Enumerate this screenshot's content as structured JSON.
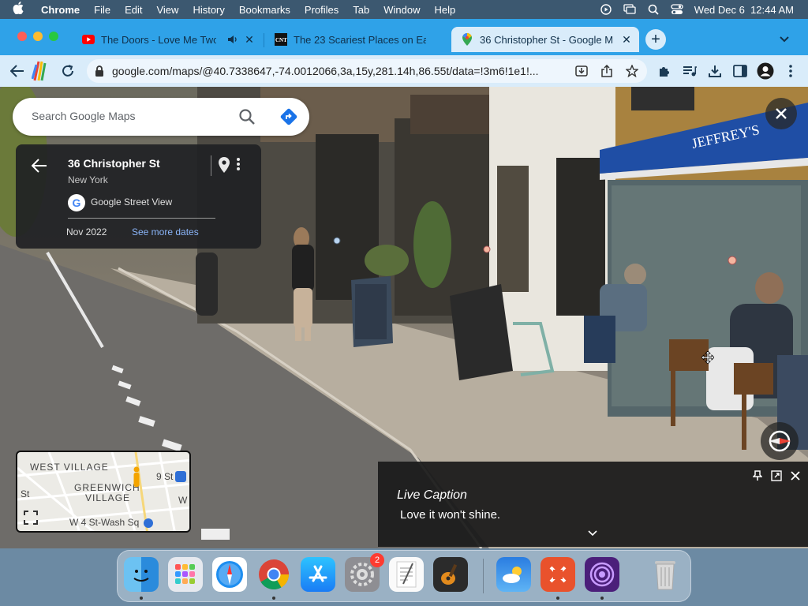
{
  "menubar": {
    "app_name": "Chrome",
    "items": [
      "File",
      "Edit",
      "View",
      "History",
      "Bookmarks",
      "Profiles",
      "Tab",
      "Window",
      "Help"
    ],
    "clock": "Wed Dec 6  12:44 AM",
    "status_icons": [
      "play-circle-icon",
      "screen-mirror-icon",
      "search-icon",
      "control-center-icon"
    ]
  },
  "tabs": [
    {
      "title": "The Doors - Love Me Two",
      "favicon": "youtube-icon",
      "audio": true,
      "active": false
    },
    {
      "title": "The 23 Scariest Places on Ea",
      "favicon": "cnt-icon",
      "audio": false,
      "active": false
    },
    {
      "title": "36 Christopher St - Google M",
      "favicon": "google-maps-icon",
      "audio": false,
      "active": true
    }
  ],
  "toolbar": {
    "url": "google.com/maps/@40.7338647,-74.0012066,3a,15y,281.14h,86.55t/data=!3m6!1e1!..."
  },
  "maps": {
    "search_placeholder": "Search Google Maps",
    "place_name": "36 Christopher St",
    "city": "New York",
    "provider": "Google Street View",
    "capture_date": "Nov 2022",
    "see_more": "See more dates",
    "minimap": {
      "labels": [
        "WEST VILLAGE",
        "GREENWICH",
        "VILLAGE",
        "9 St",
        "W 4 St-Wash Sq",
        "St",
        "W"
      ]
    }
  },
  "caption": {
    "title": "Live Caption",
    "text": "Love it won't shine."
  },
  "dock": {
    "apps": [
      {
        "name": "Finder",
        "icon": "finder-icon",
        "running": true
      },
      {
        "name": "Launchpad",
        "icon": "launchpad-icon",
        "running": false
      },
      {
        "name": "Safari",
        "icon": "safari-icon",
        "running": false
      },
      {
        "name": "Chrome",
        "icon": "chrome-icon",
        "running": true
      },
      {
        "name": "App Store",
        "icon": "app-store-icon",
        "running": false
      },
      {
        "name": "System Settings",
        "icon": "settings-icon",
        "running": false,
        "badge": "2"
      },
      {
        "name": "TextEdit",
        "icon": "textedit-icon",
        "running": false
      },
      {
        "name": "GarageBand",
        "icon": "garageband-icon",
        "running": false
      },
      {
        "name": "Weather",
        "icon": "weather-icon",
        "running": false
      },
      {
        "name": "Remote Desktop",
        "icon": "remote-desktop-icon",
        "running": true
      },
      {
        "name": "Tor Browser",
        "icon": "tor-icon",
        "running": true
      },
      {
        "name": "Trash",
        "icon": "trash-icon",
        "running": false
      }
    ]
  }
}
